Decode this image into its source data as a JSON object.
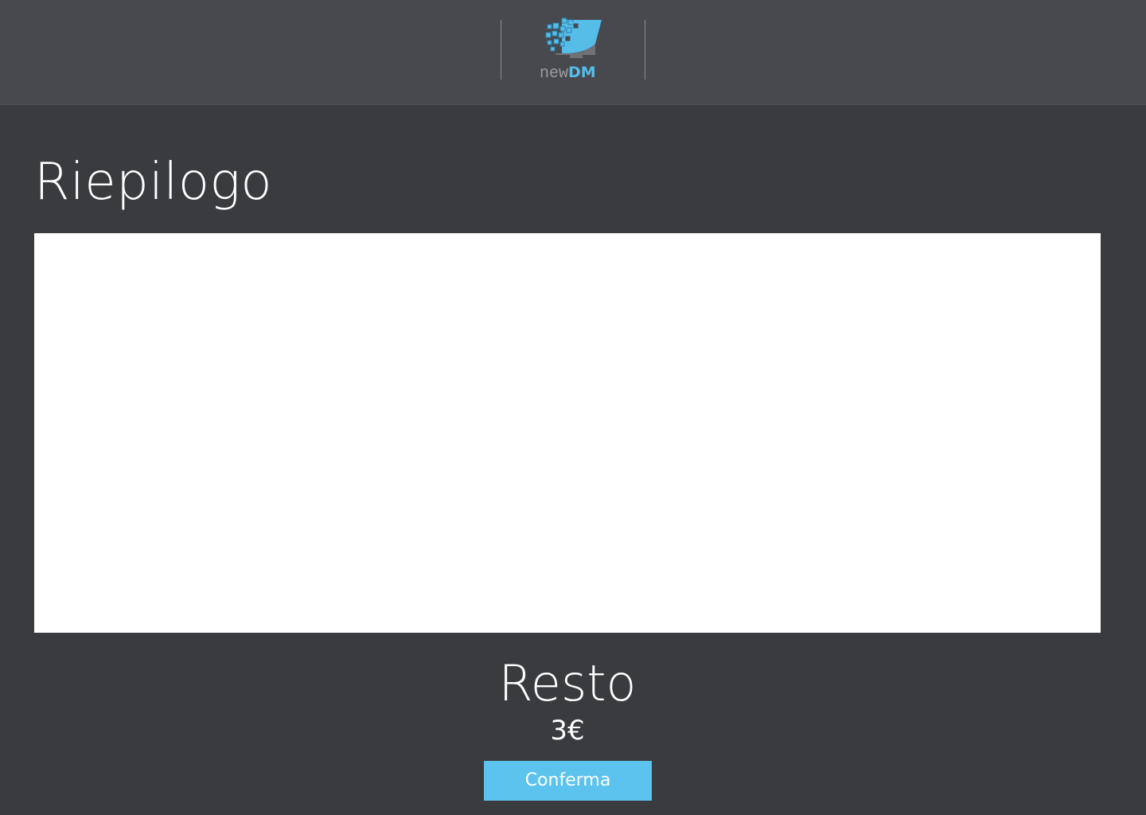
{
  "header": {
    "logo": {
      "text_new": "new",
      "text_dm": "DM",
      "icon": "monitor-pixels-logo-icon"
    }
  },
  "main": {
    "title": "Riepilogo",
    "change": {
      "label": "Resto",
      "value": "3€"
    },
    "confirm_label": "Conferma"
  },
  "colors": {
    "header_bg": "#47494e",
    "page_bg": "#3a3b3f",
    "accent": "#5bc3ee",
    "panel_bg": "#ffffff"
  }
}
